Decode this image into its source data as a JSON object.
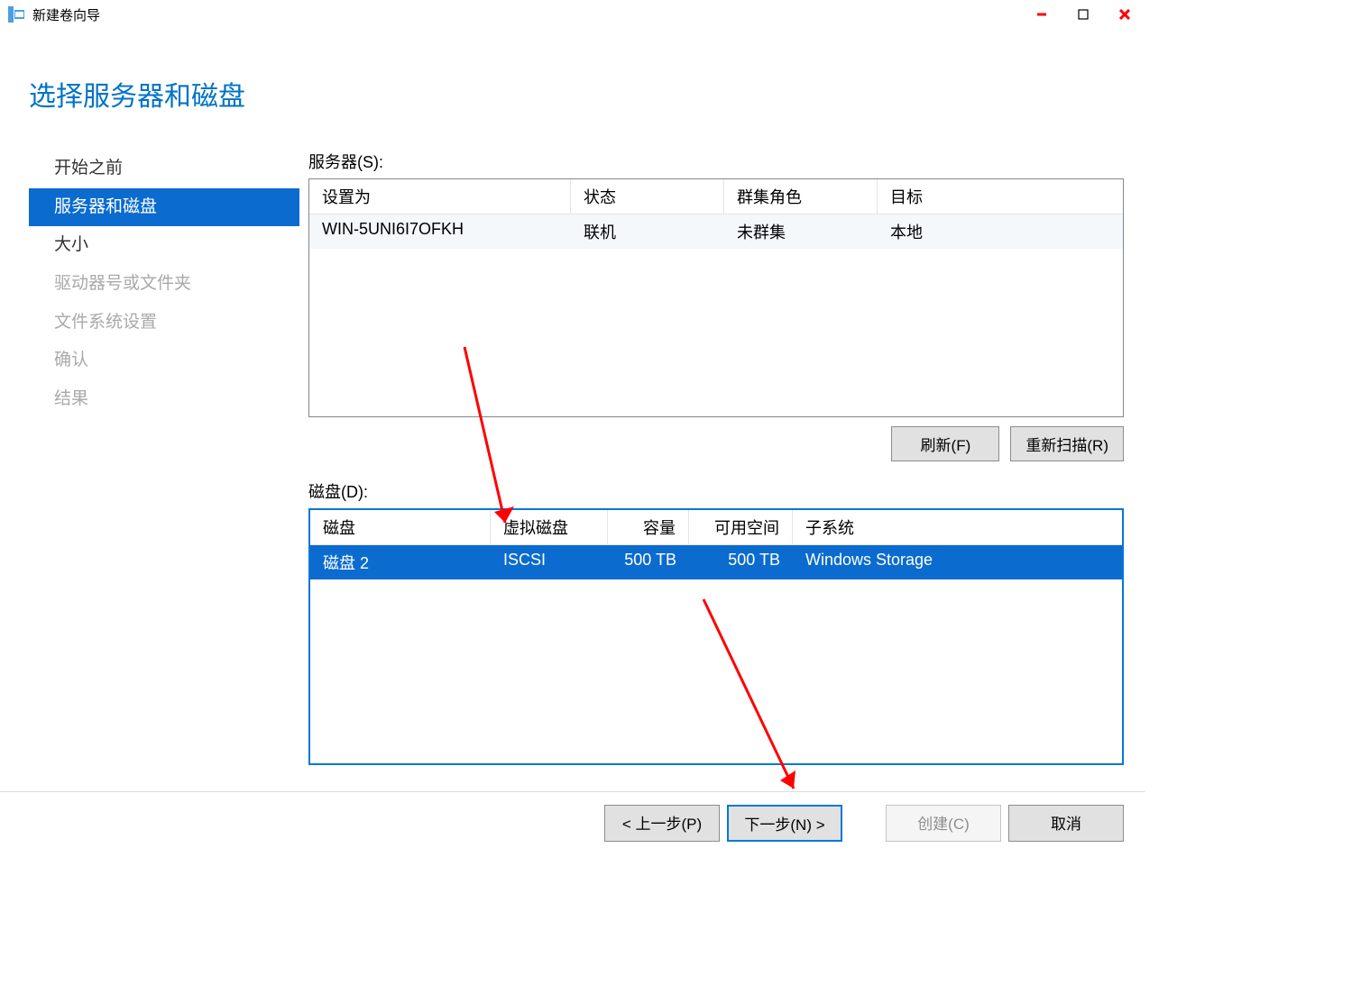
{
  "window": {
    "title": "新建卷向导"
  },
  "heading": "选择服务器和磁盘",
  "sidebar": {
    "items": [
      {
        "label": "开始之前",
        "state": "normal"
      },
      {
        "label": "服务器和磁盘",
        "state": "active"
      },
      {
        "label": "大小",
        "state": "normal"
      },
      {
        "label": "驱动器号或文件夹",
        "state": "disabled"
      },
      {
        "label": "文件系统设置",
        "state": "disabled"
      },
      {
        "label": "确认",
        "state": "disabled"
      },
      {
        "label": "结果",
        "state": "disabled"
      }
    ]
  },
  "servers": {
    "label": "服务器(S):",
    "headers": {
      "provision": "设置为",
      "status": "状态",
      "cluster": "群集角色",
      "target": "目标"
    },
    "rows": [
      {
        "provision": "WIN-5UNI6I7OFKH",
        "status": "联机",
        "cluster": "未群集",
        "target": "本地"
      }
    ]
  },
  "server_buttons": {
    "refresh": "刷新(F)",
    "rescan": "重新扫描(R)"
  },
  "disks": {
    "label": "磁盘(D):",
    "headers": {
      "disk": "磁盘",
      "vdisk": "虚拟磁盘",
      "capacity": "容量",
      "free": "可用空间",
      "subsystem": "子系统"
    },
    "rows": [
      {
        "disk": "磁盘 2",
        "vdisk": "ISCSI",
        "capacity": "500 TB",
        "free": "500 TB",
        "subsystem": "Windows Storage"
      }
    ]
  },
  "footer": {
    "prev": "< 上一步(P)",
    "next": "下一步(N) >",
    "create": "创建(C)",
    "cancel": "取消"
  }
}
